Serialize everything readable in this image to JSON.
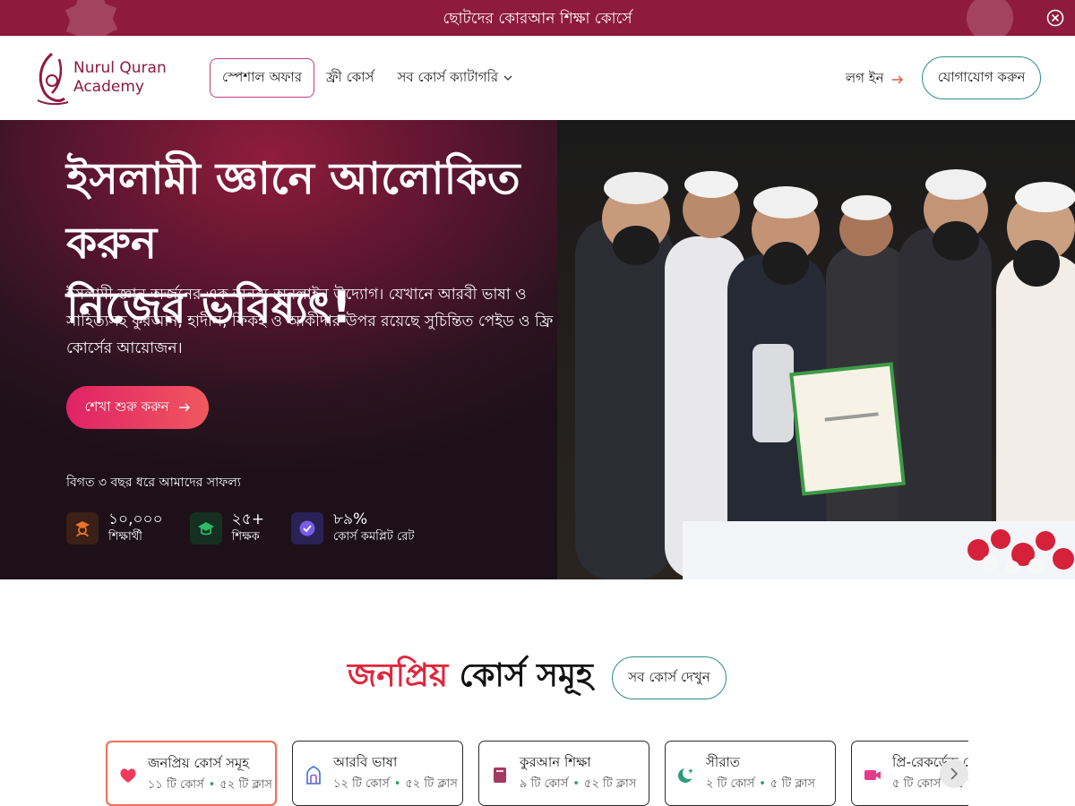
{
  "announcement": {
    "text": "ছোটদের কোরআন শিক্ষা কোর্সে",
    "close_icon": "close-circle-icon",
    "background": "#8e1a3e"
  },
  "header": {
    "logo_line1": "Nurul Quran",
    "logo_line2": "Academy",
    "nav": {
      "special_offer": "স্পেশাল অফার",
      "free_course": "ফ্রী কোর্স",
      "all_categories": "সব কোর্স ক্যাটাগরি"
    },
    "login_label": "লগ ইন",
    "contact_label": "যোগাযোগ করুন"
  },
  "hero": {
    "title_line1": "ইসলামী জ্ঞানে আলোকিত করুন",
    "title_line2": "নিজের ভবিষ্যৎ!",
    "description": "ইসলামী জ্ঞান অর্জনের এক অনন্য অনলাইন উদ্যোগ। যেখানে আরবী ভাষা ও সাহিত্যসহ কুরআন, হাদীস, ফিকহ ও আকীদার উপর রয়েছে সুচিন্তিত পেইড ও ফ্রি কোর্সের আয়োজন।",
    "cta_label": "শেখা শুরু করুন",
    "success_label": "বিগত ৩ বছর ধরে আমাদের সাফল্য",
    "stats": [
      {
        "value": "১০,০০০",
        "label": "শিক্ষার্থী",
        "icon": "student-icon",
        "color": "#e8722a"
      },
      {
        "value": "২৫+",
        "label": "শিক্ষক",
        "icon": "graduation-cap-icon",
        "color": "#2fb86a"
      },
      {
        "value": "৮৯%",
        "label": "কোর্স কমপ্লিট রেট",
        "icon": "verified-badge-icon",
        "color": "#7a5ce6"
      }
    ]
  },
  "courses": {
    "title_highlight": "জনপ্রিয়",
    "title_rest": "কোর্স সমূহ",
    "see_all_label": "সব কোর্স দেখুন",
    "categories": [
      {
        "title": "জনপ্রিয় কোর্স সমূহ",
        "courses": "১১ টি কোর্স",
        "classes": "৫২ টি ক্লাস",
        "icon": "heart-icon",
        "active": true
      },
      {
        "title": "আরবি ভাষা",
        "courses": "১২ টি কোর্স",
        "classes": "৫২ টি ক্লাস",
        "icon": "mosque-icon",
        "active": false
      },
      {
        "title": "কুরআন শিক্ষা",
        "courses": "৯ টি কোর্স",
        "classes": "৫২ টি ক্লাস",
        "icon": "book-icon",
        "active": false
      },
      {
        "title": "সীরাত",
        "courses": "২ টি কোর্স",
        "classes": "৫ টি ক্লাস",
        "icon": "crescent-star-icon",
        "active": false
      },
      {
        "title": "প্রি-রেকর্ডেড কোর্স",
        "courses": "৫ টি কোর্স",
        "classes": "৫ টি ক্লাস",
        "icon": "video-camera-icon",
        "active": false
      }
    ]
  }
}
